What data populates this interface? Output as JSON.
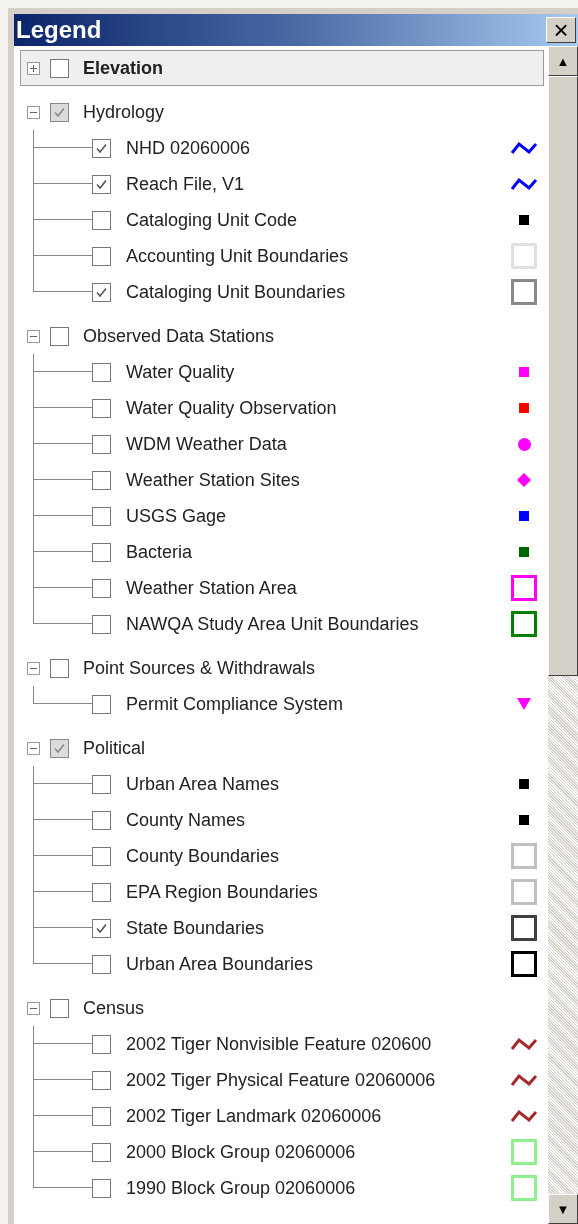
{
  "window": {
    "title": "Legend",
    "close": "×"
  },
  "scrollbar": {
    "up": "▲",
    "down": "▼"
  },
  "groups": [
    {
      "label": "Elevation",
      "expanded": false,
      "checked": false,
      "selected": true
    },
    {
      "label": "Hydrology",
      "expanded": true,
      "checked": true,
      "selected": false,
      "items": [
        {
          "label": "NHD 02060006",
          "checked": true,
          "kind": "line",
          "color": "#0000ff"
        },
        {
          "label": "Reach File, V1",
          "checked": true,
          "kind": "line",
          "color": "#0000ff"
        },
        {
          "label": "Cataloging Unit Code",
          "checked": false,
          "kind": "square",
          "color": "#000000"
        },
        {
          "label": "Accounting Unit Boundaries",
          "checked": false,
          "kind": "outline",
          "color": "#e0e0e0"
        },
        {
          "label": "Cataloging Unit Boundaries",
          "checked": true,
          "kind": "outline",
          "color": "#8a8a8a"
        }
      ]
    },
    {
      "label": "Observed Data Stations",
      "expanded": true,
      "checked": false,
      "selected": false,
      "items": [
        {
          "label": "Water Quality",
          "checked": false,
          "kind": "square",
          "color": "#ff00ff"
        },
        {
          "label": "Water Quality Observation",
          "checked": false,
          "kind": "square",
          "color": "#ff0000"
        },
        {
          "label": "WDM Weather Data",
          "checked": false,
          "kind": "circle",
          "color": "#ff00ff"
        },
        {
          "label": "Weather Station Sites",
          "checked": false,
          "kind": "diamond",
          "color": "#ff00ff"
        },
        {
          "label": "USGS Gage",
          "checked": false,
          "kind": "square",
          "color": "#0000ff"
        },
        {
          "label": "Bacteria",
          "checked": false,
          "kind": "square",
          "color": "#006400"
        },
        {
          "label": "Weather Station Area",
          "checked": false,
          "kind": "outline",
          "color": "#ff00ff"
        },
        {
          "label": "NAWQA Study Area Unit Boundaries",
          "checked": false,
          "kind": "outline",
          "color": "#008000"
        }
      ]
    },
    {
      "label": "Point Sources & Withdrawals",
      "expanded": true,
      "checked": false,
      "selected": false,
      "items": [
        {
          "label": "Permit Compliance System",
          "checked": false,
          "kind": "triangle",
          "color": "#ff00ff"
        }
      ]
    },
    {
      "label": "Political",
      "expanded": true,
      "checked": true,
      "selected": false,
      "items": [
        {
          "label": "Urban Area Names",
          "checked": false,
          "kind": "square",
          "color": "#000000"
        },
        {
          "label": "County Names",
          "checked": false,
          "kind": "square",
          "color": "#000000"
        },
        {
          "label": "County Boundaries",
          "checked": false,
          "kind": "outline",
          "color": "#c0c0c0"
        },
        {
          "label": "EPA Region Boundaries",
          "checked": false,
          "kind": "outline",
          "color": "#c0c0c0"
        },
        {
          "label": "State Boundaries",
          "checked": true,
          "kind": "outline",
          "color": "#404040"
        },
        {
          "label": "Urban Area Boundaries",
          "checked": false,
          "kind": "outline",
          "color": "#000000"
        }
      ]
    },
    {
      "label": "Census",
      "expanded": true,
      "checked": false,
      "selected": false,
      "items": [
        {
          "label": "2002 Tiger Nonvisible Feature 020600",
          "checked": false,
          "kind": "line",
          "color": "#a52a2a"
        },
        {
          "label": "2002 Tiger Physical Feature 02060006",
          "checked": false,
          "kind": "line",
          "color": "#a52a2a"
        },
        {
          "label": "2002 Tiger Landmark 02060006",
          "checked": false,
          "kind": "line",
          "color": "#a52a2a"
        },
        {
          "label": "2000 Block Group 02060006",
          "checked": false,
          "kind": "outline",
          "color": "#90ee90"
        },
        {
          "label": "1990 Block Group 02060006",
          "checked": false,
          "kind": "outline",
          "color": "#90ee90"
        }
      ]
    }
  ]
}
